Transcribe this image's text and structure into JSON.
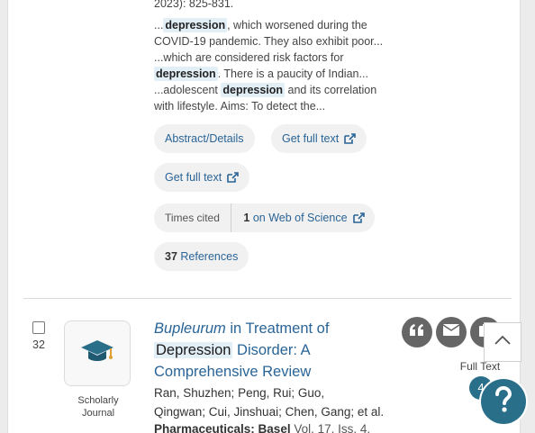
{
  "result_prev": {
    "citation_tail": "2023): 825-831.",
    "snippets": [
      {
        "pre": "...",
        "hl": "depression",
        "post": ", which worsened during the"
      },
      {
        "pre": "COVID-19 pandemic. They also exhibit poor...",
        "hl": "",
        "post": ""
      },
      {
        "pre": "...which are considered risk factors for",
        "hl": "",
        "post": ""
      },
      {
        "pre": "",
        "hl": "depression",
        "post": ". There is a paucity of Indian..."
      },
      {
        "pre": "...adolescent ",
        "hl": "depression",
        "post": " and its correlation"
      },
      {
        "pre": "with lifestyle. Aims: To detect the...",
        "hl": "",
        "post": ""
      }
    ],
    "abstract_label": "Abstract/Details",
    "full_text_label_1": "Get full text",
    "full_text_label_2": "Get full text",
    "times_cited_label": "Times cited",
    "wos_count": "1",
    "wos_label": "on Web of Science",
    "references_count": "37",
    "references_label": "References"
  },
  "result_32": {
    "number": "32",
    "source_type_line1": "Scholarly",
    "source_type_line2": "Journal",
    "title_italic": "Bupleurum",
    "title_part1": " in Treatment of",
    "title_hl": "Depression",
    "title_part2": " Disorder: A",
    "title_line3": "Comprehensive Review",
    "authors_line1": "Ran, Shuzhen; Peng, Rui; Guo,",
    "authors_line2": "Qingwan; Cui, Jinshuai; Chen, Gang; et al.",
    "journal": "Pharmaceuticals; Basel",
    "journal_tail": " Vol. 17, Iss. 4,",
    "full_text_label": "Full Text",
    "badge_count": "4"
  },
  "icons": {
    "cite": "quote-icon",
    "email": "email-icon",
    "save": "save-icon",
    "scroll_top": "chevron-up-icon",
    "help": "help-icon"
  },
  "colors": {
    "link": "#2a6496",
    "highlight": "#e3eff7",
    "badge": "#2a6f8a",
    "help": "#2a6f8a"
  }
}
